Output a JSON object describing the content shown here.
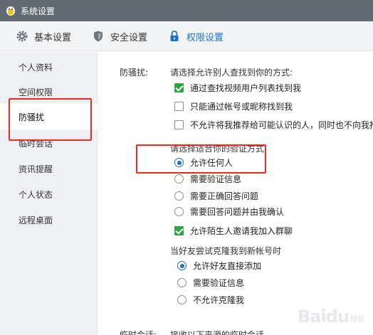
{
  "window": {
    "title": "系统设置"
  },
  "tabs": [
    {
      "label": "基本设置",
      "icon": "gear-icon"
    },
    {
      "label": "安全设置",
      "icon": "shield-icon"
    },
    {
      "label": "权限设置",
      "icon": "lock-icon"
    }
  ],
  "sidebar": {
    "items": [
      {
        "label": "个人资料"
      },
      {
        "label": "空间权限"
      },
      {
        "label": "防骚扰"
      },
      {
        "label": "临时会话"
      },
      {
        "label": "资讯提醒"
      },
      {
        "label": "个人状态"
      },
      {
        "label": "远程桌面"
      }
    ]
  },
  "anti_harass": {
    "label": "防骚扰:",
    "find_prompt": "请选择允许别人查找到你的方式:",
    "find_options": [
      {
        "label": "通过查找视频用户列表找到我",
        "checked": true
      },
      {
        "label": "只能通过帐号或昵称找到我",
        "checked": false
      },
      {
        "label": "不允许将我推荐给可能认识的人，同时也不向我推荐",
        "checked": false
      }
    ],
    "verify_prompt": "请选择适合你的验证方式",
    "verify_options": [
      {
        "label": "允许任何人",
        "selected": true
      },
      {
        "label": "需要验证信息",
        "selected": false
      },
      {
        "label": "需要正确回答问题",
        "selected": false
      },
      {
        "label": "需要回答问题并由我确认",
        "selected": false
      }
    ],
    "group_invite": {
      "label": "允许陌生人邀请我加入群聊",
      "checked": true
    },
    "clone_prompt": "当好友尝试克隆我到新帐号时",
    "clone_options": [
      {
        "label": "允许好友直接添加",
        "selected": true
      },
      {
        "label": "需要验证信息",
        "selected": false
      },
      {
        "label": "不允许克隆我",
        "selected": false
      }
    ]
  },
  "temp_session": {
    "label": "临时会话:",
    "prompt": "接收以下来源的临时会话"
  },
  "watermark": {
    "main": "Baidu",
    "sub": "经验"
  },
  "colors": {
    "titlebar": "#5f6a73",
    "accent": "#1a73c9",
    "check": "#2fa345",
    "highlight": "#ec2b24"
  }
}
